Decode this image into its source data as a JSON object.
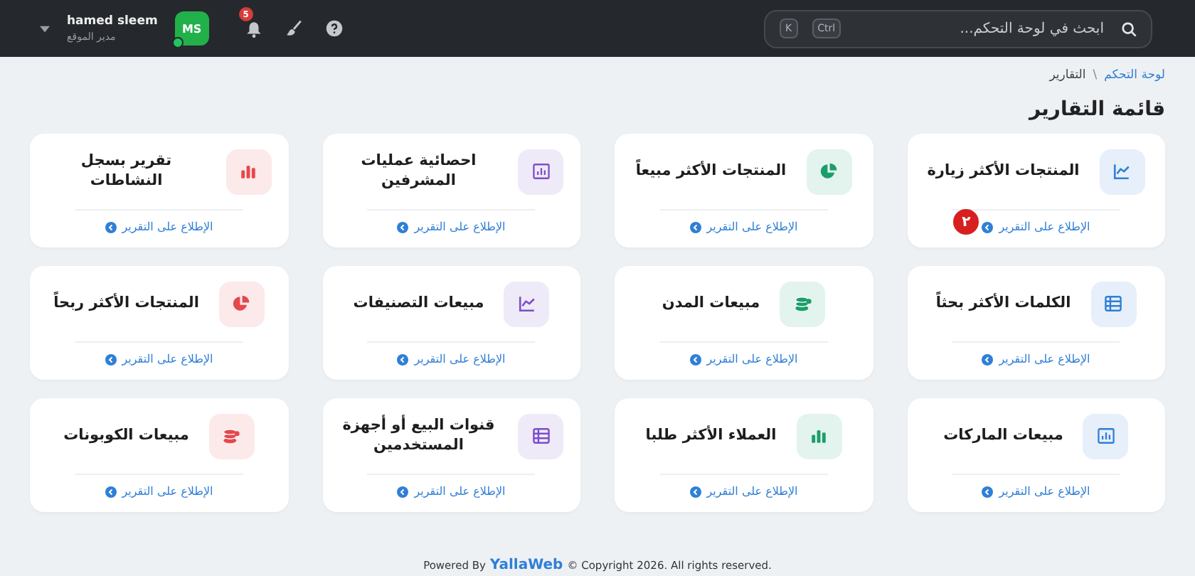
{
  "header": {
    "search": {
      "placeholder": "ابحث في لوحة التحكم...",
      "keys": [
        "Ctrl",
        "K"
      ]
    },
    "notifications": {
      "count": "5"
    },
    "user": {
      "initials": "MS",
      "online": true,
      "name": "hamed sleem",
      "role": "مدير الموقع"
    }
  },
  "breadcrumb": [
    {
      "label": "لوحة التحكم",
      "link": true
    },
    {
      "label": "التقارير",
      "link": false
    }
  ],
  "breadcrumb_separator": "\\",
  "title": "قائمة التقارير",
  "cards": [
    {
      "title": "المنتجات الأكثر زيارة",
      "kind": "line",
      "color": "#2f7fd6",
      "link": "الإطلاع على التقرير",
      "marker": "٢"
    },
    {
      "title": "المنتجات الأكثر مبيعاً",
      "kind": "pie",
      "color": "#1a9e6a",
      "link": "الإطلاع على التقرير"
    },
    {
      "title": "احصائية عمليات المشرفين",
      "kind": "columns",
      "color": "#7b4fc9",
      "link": "الإطلاع على التقرير"
    },
    {
      "title": "تقرير بسجل النشاطات",
      "kind": "bars",
      "color": "#e5484d",
      "link": "الإطلاع على التقرير"
    },
    {
      "title": "الكلمات الأكثر بحثاً",
      "kind": "table",
      "color": "#2f7fd6",
      "link": "الإطلاع على التقرير"
    },
    {
      "title": "مبيعات المدن",
      "kind": "coins",
      "color": "#1a9e6a",
      "link": "الإطلاع على التقرير"
    },
    {
      "title": "مبيعات التصنيفات",
      "kind": "line",
      "color": "#7b4fc9",
      "link": "الإطلاع على التقرير"
    },
    {
      "title": "المنتجات الأكثر ربحاً",
      "kind": "pie",
      "color": "#e5484d",
      "link": "الإطلاع على التقرير"
    },
    {
      "title": "مبيعات الماركات",
      "kind": "columns",
      "color": "#2f7fd6",
      "link": "الإطلاع على التقرير"
    },
    {
      "title": "العملاء الأكثر طلبا",
      "kind": "bars",
      "color": "#1a9e6a",
      "link": "الإطلاع على التقرير"
    },
    {
      "title": "قنوات البيع أو أجهزة المستخدمين",
      "kind": "table",
      "color": "#7b4fc9",
      "link": "الإطلاع على التقرير"
    },
    {
      "title": "مبيعات الكوبونات",
      "kind": "coins",
      "color": "#e5484d",
      "link": "الإطلاع على التقرير"
    }
  ],
  "footer": {
    "before": "Powered By",
    "link": "YallaWeb",
    "after": "© Copyright 2026. All rights reserved."
  }
}
